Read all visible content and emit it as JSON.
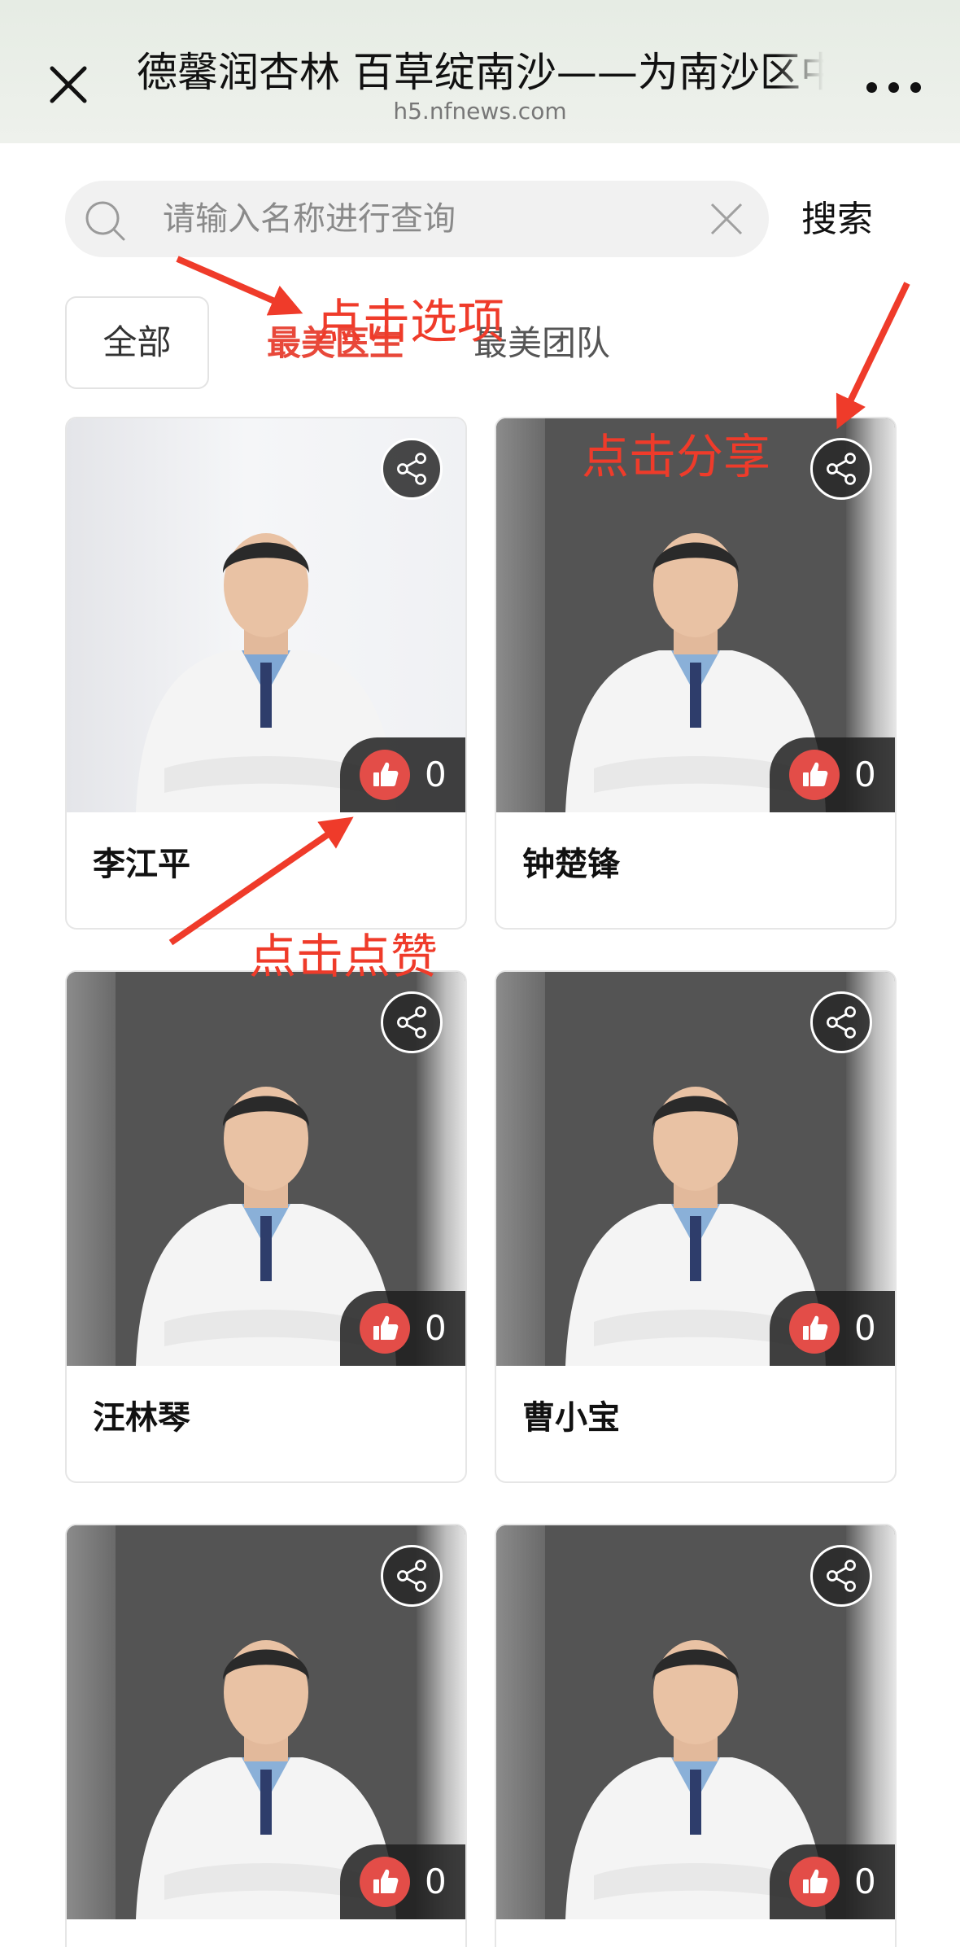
{
  "header": {
    "title": "德馨润杏林 百草绽南沙——为南沙区中",
    "domain": "h5.nfnews.com"
  },
  "search": {
    "placeholder": "请输入名称进行查询",
    "button_label": "搜索"
  },
  "tabs": [
    {
      "label": "全部"
    },
    {
      "label": "最美医生"
    },
    {
      "label": "最美团队"
    }
  ],
  "annotations": {
    "tab_hint": "点击选项",
    "share_hint": "点击分享",
    "like_hint": "点击点赞",
    "color": "#ef3b2a"
  },
  "cards": [
    {
      "name": "李江平",
      "likes": "0"
    },
    {
      "name": "钟楚锋",
      "likes": "0"
    },
    {
      "name": "汪林琴",
      "likes": "0"
    },
    {
      "name": "曹小宝",
      "likes": "0"
    },
    {
      "name": "",
      "likes": "0"
    },
    {
      "name": "",
      "likes": "0"
    }
  ],
  "colors": {
    "like_button": "#e34d48",
    "active_tab": "#e8483a",
    "photo_background": "#545454"
  },
  "icons": {
    "close": "close-icon",
    "more": "more-dots-icon",
    "search": "search-icon",
    "clear": "clear-icon",
    "share": "share-icon",
    "like": "thumbs-up-icon"
  }
}
